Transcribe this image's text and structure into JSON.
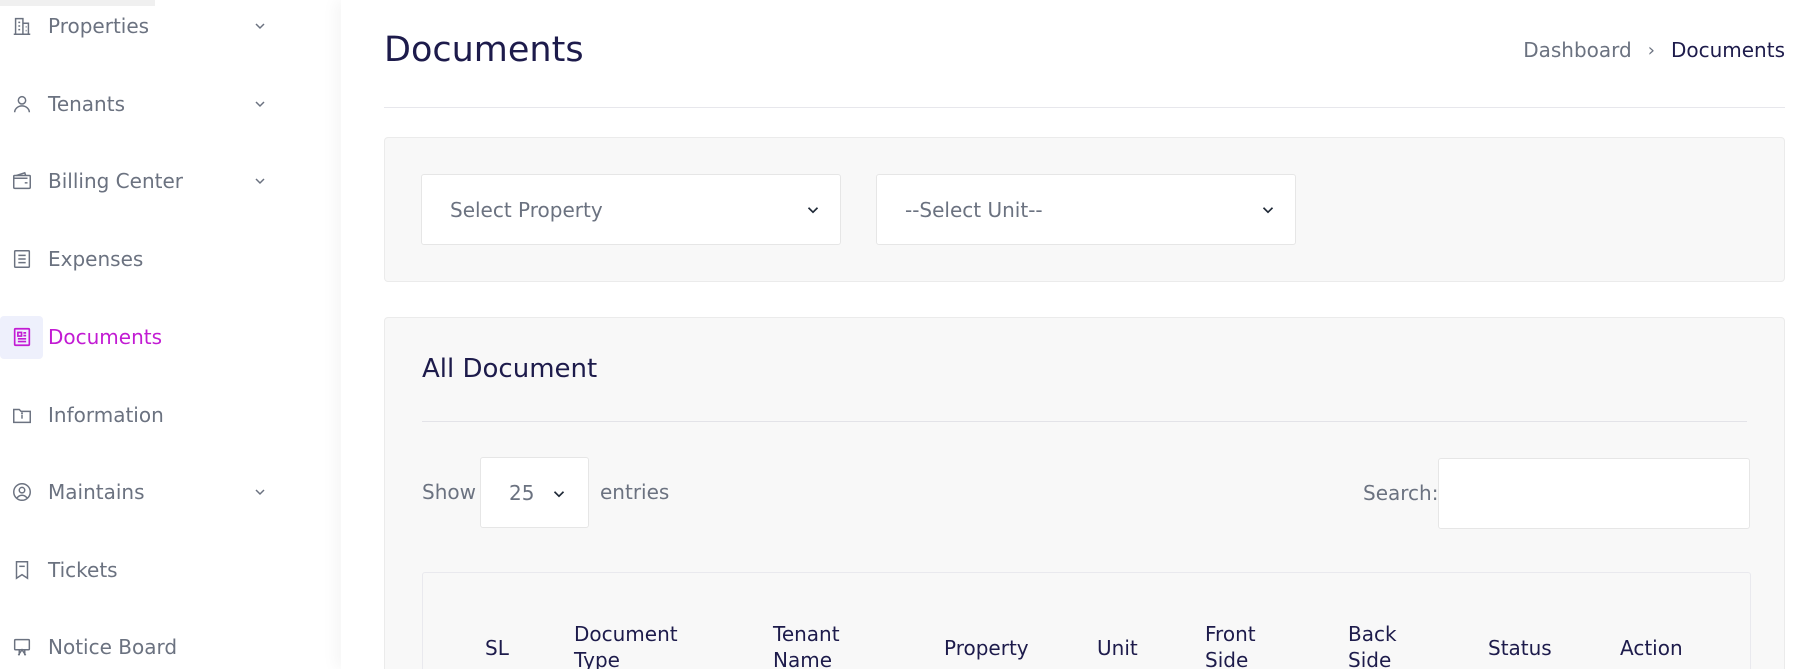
{
  "sidebar": {
    "items": [
      {
        "label": "Properties",
        "icon": "building-icon",
        "has_chevron": true,
        "active": false
      },
      {
        "label": "Tenants",
        "icon": "user-icon",
        "has_chevron": true,
        "active": false
      },
      {
        "label": "Billing Center",
        "icon": "wallet-icon",
        "has_chevron": true,
        "active": false
      },
      {
        "label": "Expenses",
        "icon": "receipt-icon",
        "has_chevron": false,
        "active": false
      },
      {
        "label": "Documents",
        "icon": "document-icon",
        "has_chevron": false,
        "active": true
      },
      {
        "label": "Information",
        "icon": "info-folder-icon",
        "has_chevron": false,
        "active": false
      },
      {
        "label": "Maintains",
        "icon": "user-circle-icon",
        "has_chevron": true,
        "active": false
      },
      {
        "label": "Tickets",
        "icon": "bookmark-icon",
        "has_chevron": false,
        "active": false
      },
      {
        "label": "Notice Board",
        "icon": "monitor-icon",
        "has_chevron": false,
        "active": false
      }
    ]
  },
  "header": {
    "title": "Documents",
    "breadcrumb": {
      "home": "Dashboard",
      "separator": "›",
      "current": "Documents"
    }
  },
  "filters": {
    "property_select": "Select Property",
    "unit_select": "--Select Unit--"
  },
  "table_card": {
    "title": "All Document",
    "show_label": "Show",
    "entries_value": "25",
    "entries_label": "entries",
    "search_label": "Search:",
    "search_value": "",
    "columns": [
      {
        "line1": "SL",
        "line2": ""
      },
      {
        "line1": "Document",
        "line2": "Type"
      },
      {
        "line1": "Tenant",
        "line2": "Name"
      },
      {
        "line1": "Property",
        "line2": ""
      },
      {
        "line1": "Unit",
        "line2": ""
      },
      {
        "line1": "Front",
        "line2": "Side"
      },
      {
        "line1": "Back",
        "line2": "Side"
      },
      {
        "line1": "Status",
        "line2": ""
      },
      {
        "line1": "Action",
        "line2": ""
      }
    ]
  },
  "colors": {
    "accent_active": "#c21bd3",
    "title_text": "#1d1b4b",
    "muted_text": "#6b7280",
    "active_icon_bg": "#eef0fc"
  }
}
